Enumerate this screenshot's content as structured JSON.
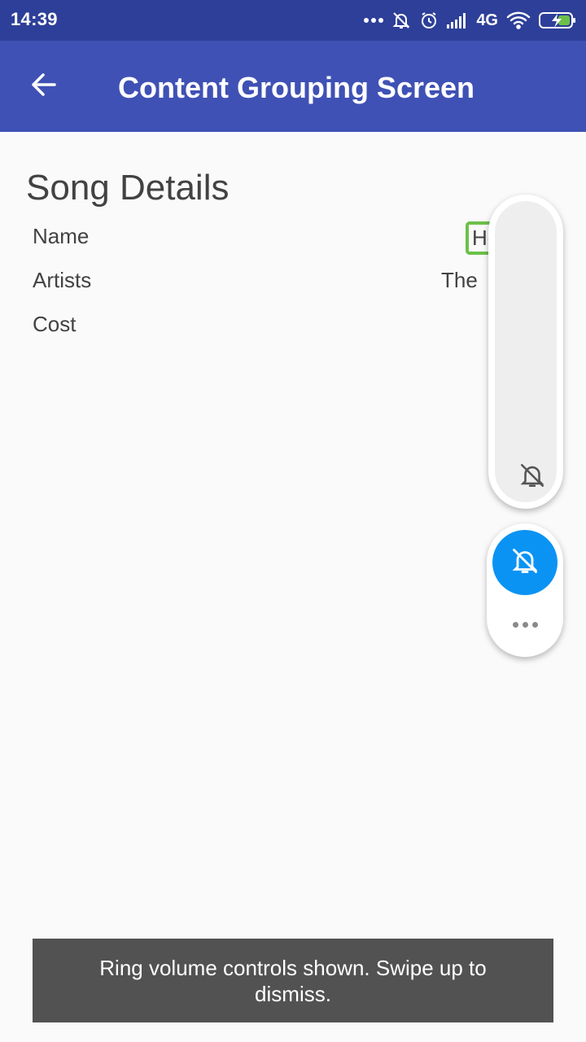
{
  "status_bar": {
    "time": "14:39",
    "network": "4G",
    "icons": [
      "more-dots-icon",
      "notifications-muted-icon",
      "alarm-icon",
      "signal-icon",
      "wifi-icon",
      "battery-charging-icon"
    ]
  },
  "app_bar": {
    "title": "Content Grouping Screen",
    "back_icon": "arrow-back-icon"
  },
  "song_details": {
    "title": "Song Details",
    "rows": [
      {
        "label": "Name",
        "value": "He"
      },
      {
        "label": "Artists",
        "value": "The"
      },
      {
        "label": "Cost",
        "value": ""
      }
    ]
  },
  "volume_overlay": {
    "track_icon": "bell-muted-icon",
    "ringer_icon": "bell-muted-icon",
    "more_icon": "more-horizontal-icon",
    "level": 0
  },
  "toast": {
    "message": "Ring volume controls shown. Swipe up to dismiss."
  },
  "colors": {
    "status_bar": "#2e3f99",
    "app_bar": "#3f51b5",
    "ringer_accent": "#0b93f3",
    "highlight": "#6cc04a"
  }
}
